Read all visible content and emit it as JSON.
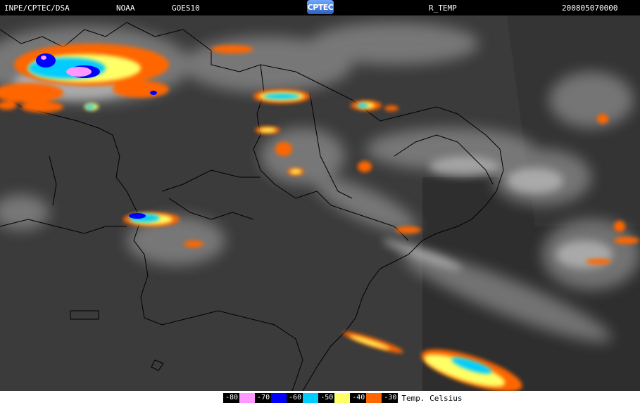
{
  "header": {
    "agency": "INPE/CPTEC/DSA",
    "source": "NOAA",
    "satellite": "GOES10",
    "logo_text": "CPTEC",
    "product": "R_TEMP",
    "timestamp": "200805070000"
  },
  "legend": {
    "title": "Temp. Celsius",
    "scale": [
      {
        "label": "-80",
        "color": "#ff99ff"
      },
      {
        "label": "-70",
        "color": "#0000ff"
      },
      {
        "label": "-60",
        "color": "#00ccff"
      },
      {
        "label": "-50",
        "color": "#ffff66"
      },
      {
        "label": "-40",
        "color": "#ff6600"
      },
      {
        "label": "-30",
        "color": ""
      }
    ]
  }
}
